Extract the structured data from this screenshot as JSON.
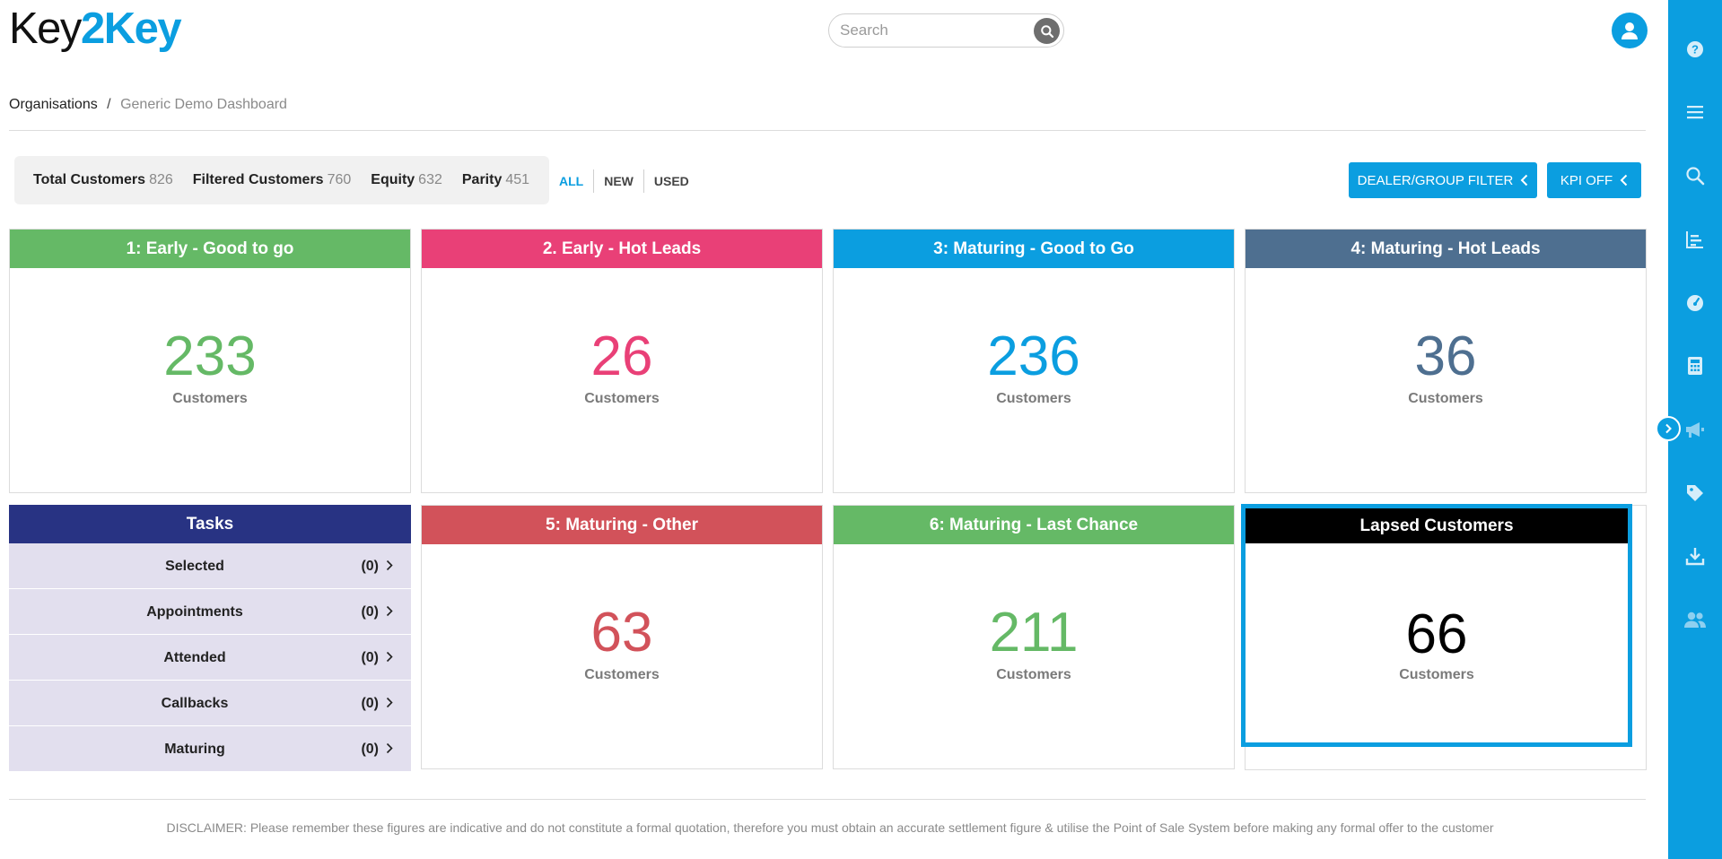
{
  "logo": {
    "part1": "Key",
    "part2": "2",
    "part3": "Key"
  },
  "search": {
    "placeholder": "Search"
  },
  "breadcrumb": {
    "root": "Organisations",
    "separator": "/",
    "current": "Generic Demo Dashboard"
  },
  "stats": [
    {
      "label": "Total Customers",
      "value": "826"
    },
    {
      "label": "Filtered Customers",
      "value": "760"
    },
    {
      "label": "Equity",
      "value": "632"
    },
    {
      "label": "Parity",
      "value": "451"
    }
  ],
  "filters": [
    "ALL",
    "NEW",
    "USED"
  ],
  "active_filter": "ALL",
  "buttons": {
    "dealer_filter": "DEALER/GROUP FILTER",
    "kpi": "KPI OFF"
  },
  "cards": [
    {
      "title": "1: Early - Good to go",
      "count": "233",
      "unit": "Customers",
      "color": "#65b966"
    },
    {
      "title": "2. Early - Hot Leads",
      "count": "26",
      "unit": "Customers",
      "color": "#e94077"
    },
    {
      "title": "3: Maturing - Good to Go",
      "count": "236",
      "unit": "Customers",
      "color": "#0b9ee0"
    },
    {
      "title": "4: Maturing - Hot Leads",
      "count": "36",
      "unit": "Customers",
      "color": "#4e6f90"
    },
    {
      "title": "5: Maturing - Other",
      "count": "63",
      "unit": "Customers",
      "color": "#d2525a"
    },
    {
      "title": "6: Maturing - Last Chance",
      "count": "211",
      "unit": "Customers",
      "color": "#65b966"
    },
    {
      "title": "Lapsed Customers",
      "count": "66",
      "unit": "Customers",
      "color": "#000000"
    }
  ],
  "tasks": {
    "title": "Tasks",
    "color": "#283383",
    "items": [
      {
        "label": "Selected",
        "count": "(0)"
      },
      {
        "label": "Appointments",
        "count": "(0)"
      },
      {
        "label": "Attended",
        "count": "(0)"
      },
      {
        "label": "Callbacks",
        "count": "(0)"
      },
      {
        "label": "Maturing",
        "count": "(0)"
      }
    ]
  },
  "disclaimer": "DISCLAIMER: Please remember these figures are indicative and do not constitute a formal quotation, therefore you must obtain an accurate settlement figure & utilise the Point of Sale System before making any formal offer to the customer",
  "sidebar_icons": [
    "help-icon",
    "menu-icon",
    "search-icon",
    "bar-chart-icon",
    "gauge-icon",
    "calculator-icon",
    "megaphone-icon",
    "tag-icon",
    "download-icon",
    "users-icon"
  ],
  "accent_color": "#0b9ee0"
}
